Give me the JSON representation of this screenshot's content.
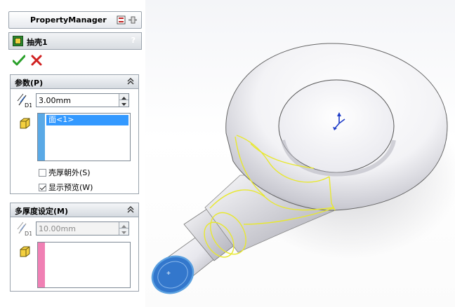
{
  "property_manager": {
    "title": "PropertyManager"
  },
  "feature": {
    "name": "抽壳1",
    "help": "?"
  },
  "parameters": {
    "title": "参数(P)",
    "thickness": "3.00mm",
    "faces": [
      "面<1>"
    ],
    "shell_outward_label": "壳厚朝外(S)",
    "shell_outward_checked": false,
    "show_preview_label": "显示预览(W)",
    "show_preview_checked": true
  },
  "multi_thickness": {
    "title": "多厚度设定(M)",
    "thickness": "10.00mm",
    "faces": []
  },
  "colors": {
    "selection_blue": "#3399ff",
    "face_list_strip": "#5aa9e6",
    "multi_list_strip": "#f080b4",
    "preview_yellow": "#e8e830",
    "selected_face": "#3377cc"
  }
}
